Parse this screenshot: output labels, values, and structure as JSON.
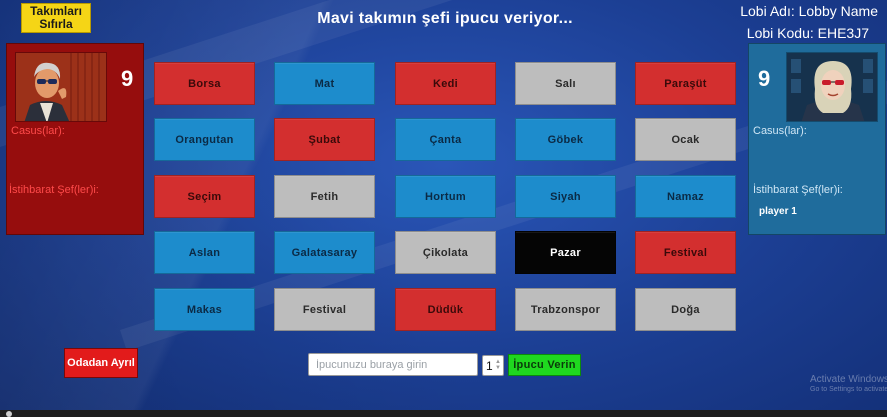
{
  "header": {
    "reset_label": "Takımları Sıfırla",
    "status": "Mavi takımın şefi ipucu veriyor...",
    "lobby_name": "Lobi Adı: Lobby Name",
    "lobby_code": "Lobi Kodu: EHE3J7"
  },
  "red_team": {
    "score": "9",
    "spies_label": "Casus(lar):",
    "chiefs_label": "İstihbarat Şef(ler)i:",
    "spies": [],
    "chiefs": []
  },
  "blue_team": {
    "score": "9",
    "spies_label": "Casus(lar):",
    "chiefs_label": "İstihbarat Şef(ler)i:",
    "spies": [],
    "chiefs": [
      "player 1"
    ]
  },
  "board": [
    {
      "word": "Borsa",
      "color": "red"
    },
    {
      "word": "Mat",
      "color": "blue"
    },
    {
      "word": "Kedi",
      "color": "red"
    },
    {
      "word": "Salı",
      "color": "neutral"
    },
    {
      "word": "Paraşüt",
      "color": "red"
    },
    {
      "word": "Orangutan",
      "color": "blue"
    },
    {
      "word": "Şubat",
      "color": "red"
    },
    {
      "word": "Çanta",
      "color": "blue"
    },
    {
      "word": "Göbek",
      "color": "blue"
    },
    {
      "word": "Ocak",
      "color": "neutral"
    },
    {
      "word": "Seçim",
      "color": "red"
    },
    {
      "word": "Fetih",
      "color": "neutral"
    },
    {
      "word": "Hortum",
      "color": "blue"
    },
    {
      "word": "Siyah",
      "color": "blue"
    },
    {
      "word": "Namaz",
      "color": "blue"
    },
    {
      "word": "Aslan",
      "color": "blue"
    },
    {
      "word": "Galatasaray",
      "color": "blue"
    },
    {
      "word": "Çikolata",
      "color": "neutral"
    },
    {
      "word": "Pazar",
      "color": "black"
    },
    {
      "word": "Festival",
      "color": "red"
    },
    {
      "word": "Makas",
      "color": "blue"
    },
    {
      "word": "Festival",
      "color": "neutral"
    },
    {
      "word": "Düdük",
      "color": "red"
    },
    {
      "word": "Trabzonspor",
      "color": "neutral"
    },
    {
      "word": "Doğa",
      "color": "neutral"
    }
  ],
  "controls": {
    "leave_label": "Odadan Ayrıl",
    "clue_placeholder": "İpucunuzu buraya girin",
    "count_value": "1",
    "give_label": "İpucu Verin"
  },
  "watermark": {
    "line1": "Activate Windows",
    "line2": "Go to Settings to activate Windows."
  },
  "colors": {
    "red_card": "#d32f2f",
    "blue_card": "#1d8ccc",
    "neutral_card": "#bdbdbd",
    "assassin_card": "#050505",
    "red_panel": "#960d0d",
    "blue_panel": "#1f6c9c"
  }
}
